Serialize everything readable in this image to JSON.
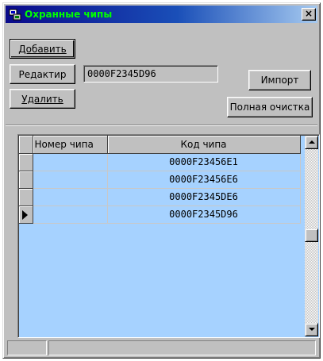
{
  "window": {
    "title": "Охранные чипы",
    "close_label": "×"
  },
  "toolbar": {
    "add_label": "Добавить",
    "edit_label": "Редактир",
    "delete_label": "Удалить",
    "import_label": "Импорт",
    "clear_all_label": "Полная очистка"
  },
  "chip_field": {
    "value": "0000F2345D96"
  },
  "grid": {
    "columns": [
      "Номер чипа",
      "Код чипа"
    ],
    "rows": [
      {
        "number": "",
        "code": "0000F23456E1"
      },
      {
        "number": "",
        "code": "0000F23456E6"
      },
      {
        "number": "",
        "code": "0000F2345DE6"
      },
      {
        "number": "",
        "code": "0000F2345D96"
      }
    ],
    "current_row": 4
  },
  "colors": {
    "title_text": "#00ff00",
    "grid_background": "#a6d2ff",
    "window_face": "#c0c0c0"
  },
  "status": {
    "panel1": "",
    "panel2": ""
  }
}
